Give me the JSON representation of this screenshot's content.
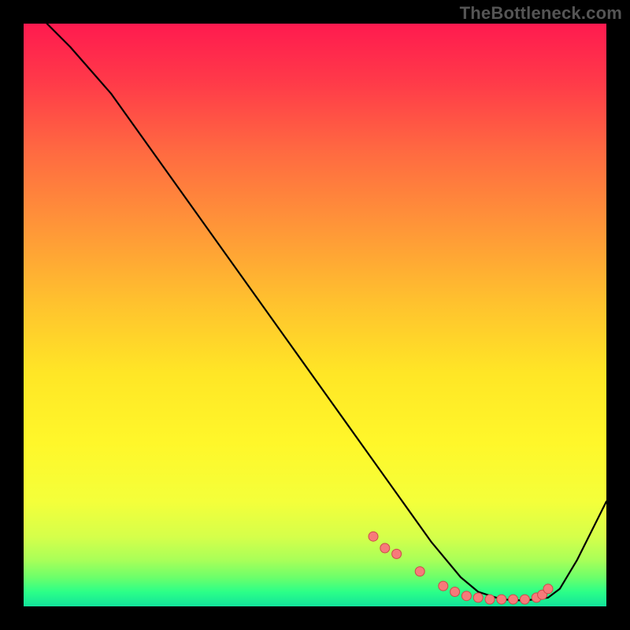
{
  "watermark": "TheBottleneck.com",
  "colors": {
    "bg": "#000000",
    "watermark": "#555555",
    "curve": "#000000",
    "marker_fill": "#f77a7a",
    "marker_stroke": "#cc4a4a",
    "gradient_stops": [
      {
        "offset": 0.0,
        "color": "#ff1a4f"
      },
      {
        "offset": 0.1,
        "color": "#ff3a49"
      },
      {
        "offset": 0.22,
        "color": "#ff6a41"
      },
      {
        "offset": 0.35,
        "color": "#ff9638"
      },
      {
        "offset": 0.48,
        "color": "#ffc22e"
      },
      {
        "offset": 0.6,
        "color": "#ffe626"
      },
      {
        "offset": 0.72,
        "color": "#fff72a"
      },
      {
        "offset": 0.82,
        "color": "#f4ff3a"
      },
      {
        "offset": 0.88,
        "color": "#d6ff4a"
      },
      {
        "offset": 0.92,
        "color": "#aaff58"
      },
      {
        "offset": 0.95,
        "color": "#6dff6a"
      },
      {
        "offset": 0.975,
        "color": "#2cff88"
      },
      {
        "offset": 1.0,
        "color": "#12e39a"
      }
    ]
  },
  "chart_data": {
    "type": "line",
    "title": "",
    "xlabel": "",
    "ylabel": "",
    "xlim": [
      0,
      100
    ],
    "ylim": [
      0,
      100
    ],
    "grid": false,
    "legend": false,
    "background": "heatmap-gradient-vertical",
    "description": "A V-shaped bottleneck curve over a vertical red-to-green gradient. Curve starts near 100% at x≈4, descends roughly linearly to ~0% around x≈75–90, then rises toward ~18% at x=100. Red dots mark the low region between x≈60 and x≈90.",
    "series": [
      {
        "name": "bottleneck-curve",
        "x": [
          4,
          8,
          15,
          25,
          35,
          45,
          55,
          60,
          65,
          70,
          75,
          78,
          82,
          86,
          90,
          92,
          95,
          100
        ],
        "y": [
          100,
          96,
          88,
          74,
          60,
          46,
          32,
          25,
          18,
          11,
          5,
          2.5,
          1.2,
          1.0,
          1.5,
          3,
          8,
          18
        ]
      }
    ],
    "markers": {
      "name": "marked-points",
      "x": [
        60,
        62,
        64,
        68,
        72,
        74,
        76,
        78,
        80,
        82,
        84,
        86,
        88,
        89,
        90
      ],
      "y": [
        12,
        10,
        9,
        6,
        3.5,
        2.5,
        1.8,
        1.5,
        1.2,
        1.2,
        1.2,
        1.2,
        1.5,
        2.0,
        3.0
      ]
    }
  }
}
